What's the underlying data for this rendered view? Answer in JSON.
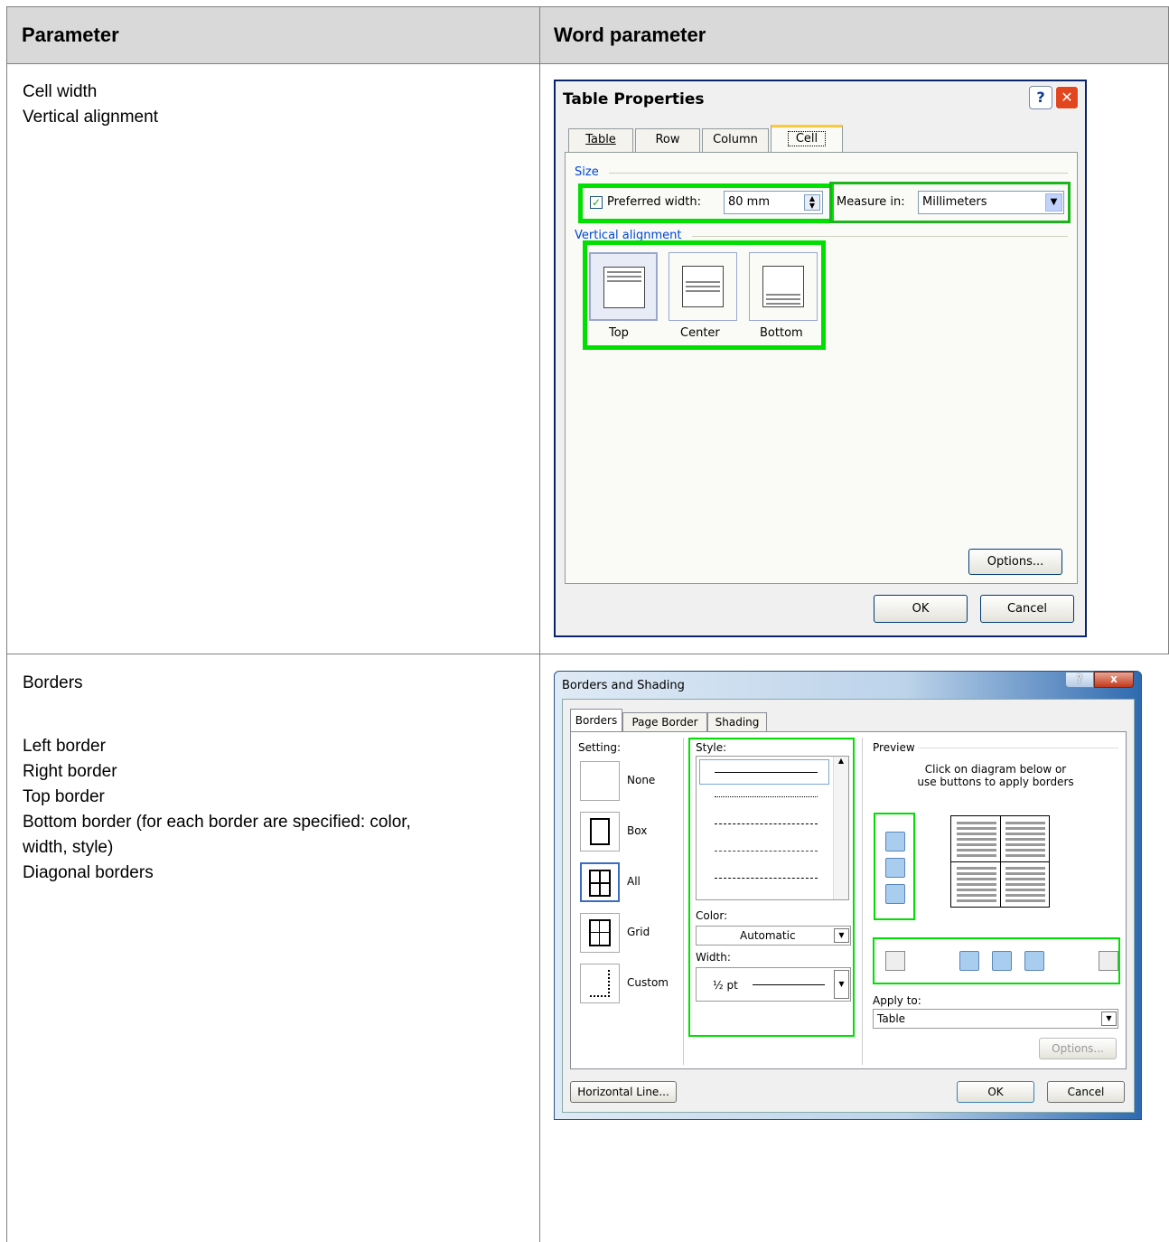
{
  "table": {
    "header": {
      "col1": "Parameter",
      "col2": "Word parameter"
    },
    "rows": [
      {
        "params": [
          "Cell width",
          "Vertical alignment"
        ]
      },
      {
        "params": [
          "Borders",
          "",
          "Left border",
          "Right border",
          "Top border",
          "Bottom border (for each border are specified: color,",
          "width, style)",
          "Diagonal borders"
        ]
      }
    ]
  },
  "table_properties": {
    "title": "Table Properties",
    "help": "?",
    "close": "✕",
    "tabs": [
      "Table",
      "Row",
      "Column",
      "Cell"
    ],
    "size_group": "Size",
    "preferred_width_label": "Preferred width:",
    "preferred_width_value": "80 mm",
    "measure_in_label": "Measure in:",
    "measure_in_value": "Millimeters",
    "vertical_alignment_group": "Vertical alignment",
    "alignments": [
      "Top",
      "Center",
      "Bottom"
    ],
    "options_button": "Options...",
    "ok_button": "OK",
    "cancel_button": "Cancel"
  },
  "borders_shading": {
    "title": "Borders and Shading",
    "help": "?",
    "close": "x",
    "tabs": [
      "Borders",
      "Page Border",
      "Shading"
    ],
    "setting_label": "Setting:",
    "settings": [
      "None",
      "Box",
      "All",
      "Grid",
      "Custom"
    ],
    "style_label": "Style:",
    "color_label": "Color:",
    "color_value": "Automatic",
    "width_label": "Width:",
    "width_value": "½ pt",
    "preview_label": "Preview",
    "preview_hint": "Click on diagram below or use buttons to apply borders",
    "apply_to_label": "Apply to:",
    "apply_to_value": "Table",
    "options_button": "Options...",
    "horizontal_line_button": "Horizontal Line...",
    "ok_button": "OK",
    "cancel_button": "Cancel"
  }
}
